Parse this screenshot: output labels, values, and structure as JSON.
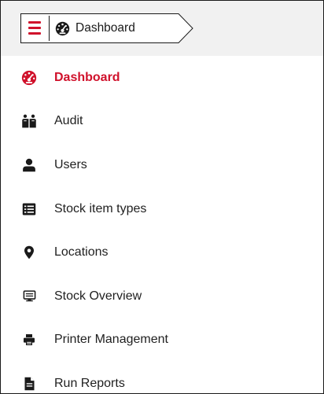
{
  "colors": {
    "accent": "#d0112b",
    "text": "#1f1f1f",
    "topbar_bg": "#f1f1f1"
  },
  "header": {
    "menu_icon": "hamburger-menu-icon",
    "breadcrumb": {
      "icon": "dashboard-gauge-icon",
      "label": "Dashboard"
    }
  },
  "menu": {
    "active": "Dashboard",
    "items": [
      {
        "label": "Dashboard",
        "icon": "dashboard-gauge-icon"
      },
      {
        "label": "Audit",
        "icon": "audit-people-book-icon"
      },
      {
        "label": "Users",
        "icon": "user-icon"
      },
      {
        "label": "Stock item types",
        "icon": "list-box-icon"
      },
      {
        "label": "Locations",
        "icon": "map-marker-icon"
      },
      {
        "label": "Stock Overview",
        "icon": "monitor-icon"
      },
      {
        "label": "Printer Management",
        "icon": "printer-icon"
      },
      {
        "label": "Run Reports",
        "icon": "report-file-icon"
      }
    ]
  }
}
